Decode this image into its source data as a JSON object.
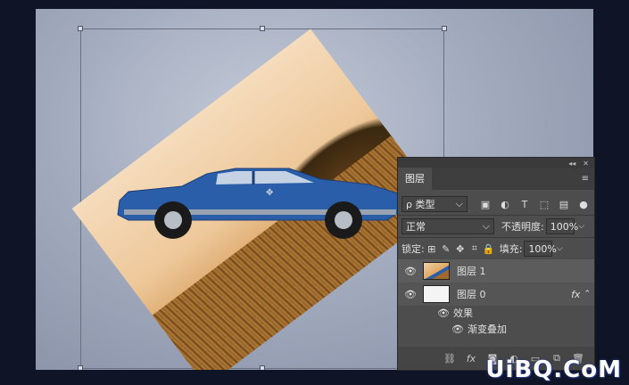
{
  "colors": {
    "accent": "#4d4d4d",
    "car": "#2b5ea8",
    "sepia": "#e6b06a"
  },
  "canvas": {
    "alt_icon": "photo-layer-icon"
  },
  "layers_panel": {
    "collapse_label": "◂◂",
    "close_label": "✕",
    "tab_title": "图层",
    "menu_icon": "menu-lines-icon",
    "filter": {
      "label": "ρ 类型",
      "arrow": "⌵"
    },
    "blend": {
      "mode": "正常",
      "opacity_label": "不透明度:",
      "opacity_value": "100%"
    },
    "lock": {
      "label": "锁定:",
      "fill_label": "填充:",
      "fill_value": "100%"
    },
    "layers": [
      {
        "name": "图层 1",
        "visible": true
      },
      {
        "name": "图层 0",
        "visible": true,
        "fx": "fx"
      }
    ],
    "effects": {
      "label": "效果",
      "items": [
        "渐变叠加"
      ]
    },
    "bottom_icons": [
      "link-icon",
      "fx-icon",
      "mask-icon",
      "adjustment-icon",
      "folder-icon",
      "new-layer-icon",
      "trash-icon"
    ]
  },
  "watermark": {
    "text": "UiBQ.CoM"
  }
}
